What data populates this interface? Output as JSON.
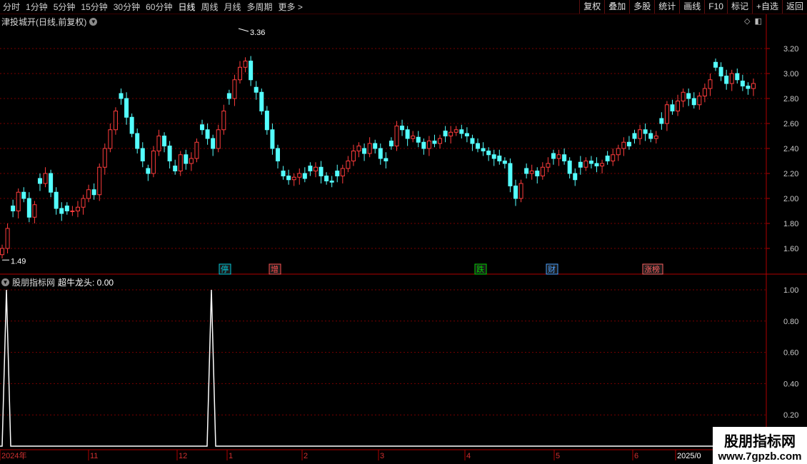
{
  "toolbar": {
    "periods": [
      "分时",
      "1分钟",
      "5分钟",
      "15分钟",
      "30分钟",
      "60分钟",
      "日线",
      "周线",
      "月线",
      "多周期",
      "更多 >"
    ],
    "active_period": "日线",
    "tools": [
      "复权",
      "叠加",
      "多股",
      "统计",
      "画线",
      "F10",
      "标记",
      "+自选",
      "返回"
    ]
  },
  "main_chart": {
    "title": "津投城开(日线,前复权)",
    "price_labels": [
      "3.20",
      "3.00",
      "2.80",
      "2.60",
      "2.40",
      "2.20",
      "2.00",
      "1.80",
      "1.60"
    ],
    "high_label": "3.36",
    "low_label": "1.49",
    "event_tags": [
      {
        "text": "停",
        "color": "#00c8d8"
      },
      {
        "text": "增",
        "color": "#ff5050"
      },
      {
        "text": "跌",
        "color": "#00d000"
      },
      {
        "text": "财",
        "color": "#4aa0ff"
      },
      {
        "text": "涨榜",
        "color": "#ff6060"
      }
    ],
    "colors": {
      "up": "#ff3c3c",
      "down": "#54ffff",
      "grid": "#7a0000",
      "axis": "#b00000"
    }
  },
  "indicator": {
    "name": "股朋指标网",
    "label": "超牛龙头: 0.00",
    "axis_labels": [
      "1.00",
      "0.80",
      "0.60",
      "0.40",
      "0.20"
    ]
  },
  "date_axis": [
    "2024年",
    "11",
    "12",
    "1",
    "2",
    "3",
    "4",
    "5",
    "6",
    "2025/0"
  ],
  "watermark": {
    "line1": "股朋指标网",
    "line2": "www.7gpzb.com"
  }
}
